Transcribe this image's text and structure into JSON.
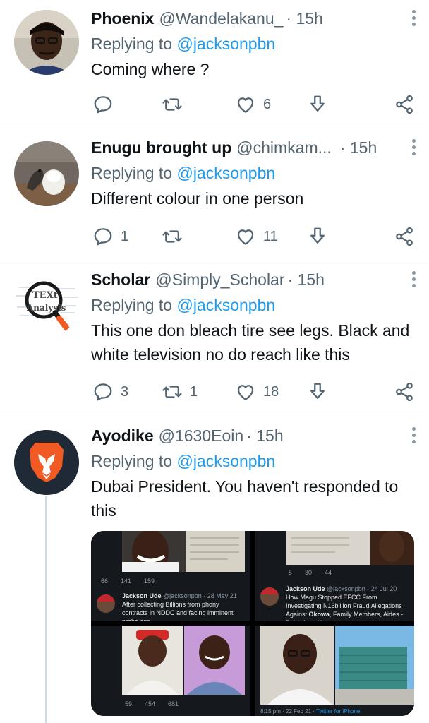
{
  "tweets": [
    {
      "name": "Phoenix",
      "handle": "@Wandelakanu_",
      "time": "· 15h",
      "replying_prefix": "Replying to ",
      "replying_to": "@jacksonpbn",
      "text": "Coming where ?",
      "replies": "",
      "retweets": "",
      "likes": "6"
    },
    {
      "name": "Enugu brought up",
      "handle": "@chimkam...",
      "time": "· 15h",
      "replying_prefix": "Replying to ",
      "replying_to": "@jacksonpbn",
      "text": "Different colour in one person",
      "replies": "1",
      "retweets": "",
      "likes": "11"
    },
    {
      "name": "Scholar",
      "handle": "@Simply_Scholar",
      "time": "· 15h",
      "replying_prefix": "Replying to ",
      "replying_to": "@jacksonpbn",
      "text": "This one don bleach tire see legs. Black and white television no do reach like this",
      "replies": "3",
      "retweets": "1",
      "likes": "18"
    },
    {
      "name": "Ayodike",
      "handle": "@1630Eoin",
      "time": "· 15h",
      "replying_prefix": "Replying to ",
      "replying_to": "@jacksonpbn",
      "text": "Dubai President. You haven't responded to this"
    }
  ],
  "avatar_labels": {
    "scholar_line1": "TEXt",
    "scholar_line2": "Analysis"
  },
  "media": {
    "panel1": {
      "stats": [
        "66",
        "141",
        "159"
      ],
      "name": "Jackson Ude",
      "meta": "@jacksonpbn · 28 May 21",
      "text": "After collecting Billions from phony contracts in NDDC and facing imminent probe and"
    },
    "panel2": {
      "stats": [
        "5",
        "30",
        "44"
      ],
      "name": "Jackson Ude",
      "meta": "@jacksonpbn · 24 Jul 20",
      "text_pre": "How Magu Stopped EFCC From Investigating N16billion Fraud Allegations Against ",
      "text_bold": "Okowa",
      "text_post": ", Family Members, Aides - Pointblank News"
    },
    "panel3": {
      "stats": [
        "59",
        "454",
        "681"
      ]
    },
    "panel4": {
      "footer": "8:15 pm · 22 Feb 21 · ",
      "footer_link": "Twitter for iPhone"
    }
  },
  "colors": {
    "link_blue": "#1d9bf0",
    "secondary_text": "#536471",
    "brave_orange": "#f15a22"
  }
}
